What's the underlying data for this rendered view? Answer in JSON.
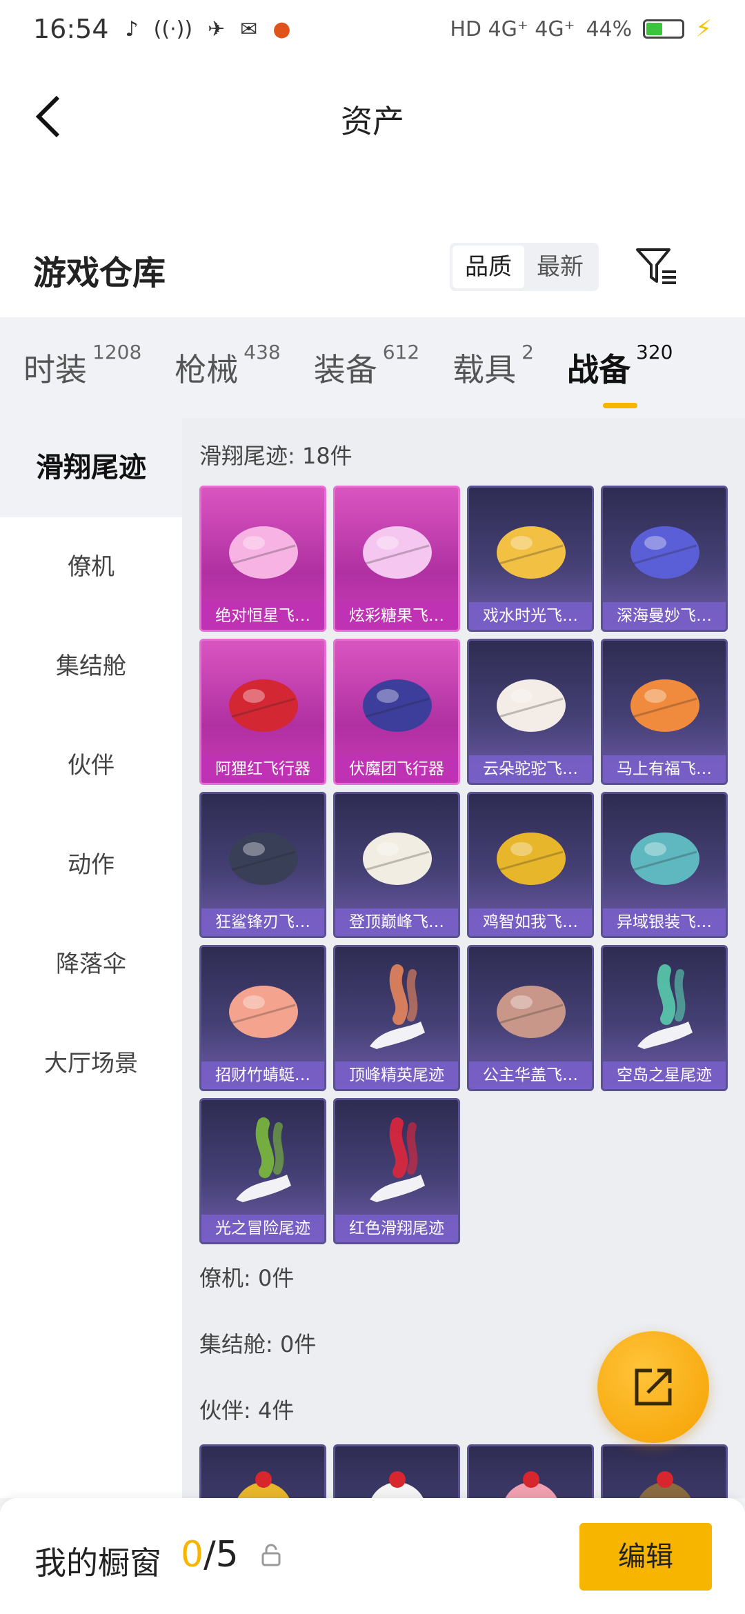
{
  "status_bar": {
    "time": "16:54",
    "network": "HD 4G⁺ 4G⁺",
    "battery": "44%",
    "battery_level": 0.44,
    "app_icons": [
      "tiktok-icon",
      "radio-icon",
      "drone-icon",
      "mail-icon",
      "pumpkin-icon"
    ]
  },
  "header": {
    "title": "资产"
  },
  "warehouse": {
    "title": "游戏仓库",
    "sort_options": [
      "品质",
      "最新"
    ],
    "sort_selected": "品质"
  },
  "tabs": [
    {
      "label": "时装",
      "count": "1208"
    },
    {
      "label": "枪械",
      "count": "438"
    },
    {
      "label": "装备",
      "count": "612"
    },
    {
      "label": "载具",
      "count": "2"
    },
    {
      "label": "战备",
      "count": "320",
      "active": true
    }
  ],
  "sidebar": {
    "items": [
      "滑翔尾迹",
      "僚机",
      "集结舱",
      "伙伴",
      "动作",
      "降落伞",
      "大厅场景"
    ],
    "active": "滑翔尾迹"
  },
  "sections": {
    "glide_trail": {
      "title": "滑翔尾迹: 18件",
      "items": [
        {
          "name": "绝对恒星飞…",
          "rarity": "pink",
          "icon": "planet-aircraft-icon"
        },
        {
          "name": "炫彩糖果飞…",
          "rarity": "pink",
          "icon": "candy-aircraft-icon"
        },
        {
          "name": "戏水时光飞…",
          "rarity": "purple",
          "icon": "giraffe-float-icon"
        },
        {
          "name": "深海曼妙飞…",
          "rarity": "purple",
          "icon": "manta-board-icon"
        },
        {
          "name": "阿狸红飞行器",
          "rarity": "pink",
          "icon": "red-plane-icon"
        },
        {
          "name": "伏魔团飞行器",
          "rarity": "pink",
          "icon": "blue-jet-icon"
        },
        {
          "name": "云朵驼驼飞…",
          "rarity": "purple",
          "icon": "alpaca-icon"
        },
        {
          "name": "马上有福飞…",
          "rarity": "purple",
          "icon": "pony-icon"
        },
        {
          "name": "狂鲨锋刃飞…",
          "rarity": "purple",
          "icon": "shark-icon"
        },
        {
          "name": "登顶巅峰飞…",
          "rarity": "purple",
          "icon": "white-glider-icon"
        },
        {
          "name": "鸡智如我飞…",
          "rarity": "purple",
          "icon": "chicken-icon"
        },
        {
          "name": "异域银装飞…",
          "rarity": "purple",
          "icon": "silver-wing-icon"
        },
        {
          "name": "招财竹蜻蜓…",
          "rarity": "purple",
          "icon": "helicopter-icon"
        },
        {
          "name": "顶峰精英尾迹",
          "rarity": "purple",
          "icon": "smoke-trail-icon"
        },
        {
          "name": "公主华盖飞…",
          "rarity": "purple",
          "icon": "canopy-icon"
        },
        {
          "name": "空岛之星尾迹",
          "rarity": "purple",
          "icon": "rainbow-trail-icon"
        },
        {
          "name": "光之冒险尾迹",
          "rarity": "purple",
          "icon": "green-trail-icon"
        },
        {
          "name": "红色滑翔尾迹",
          "rarity": "purple",
          "icon": "red-trail-icon"
        }
      ]
    },
    "wingman": {
      "title": "僚机: 0件"
    },
    "assembly_pod": {
      "title": "集结舱: 0件"
    },
    "companion": {
      "title": "伙伴: 4件",
      "icons": [
        "companion-chicken-icon",
        "companion-egg-icon",
        "companion-girl-icon",
        "companion-soldier-icon"
      ]
    }
  },
  "bottom": {
    "title": "我的橱窗",
    "count_current": "0",
    "count_total": "/5",
    "edit_label": "编辑"
  },
  "colors": {
    "accent": "#f7b500",
    "pink_card": "#c83cb4",
    "purple_card": "#4a4378"
  }
}
